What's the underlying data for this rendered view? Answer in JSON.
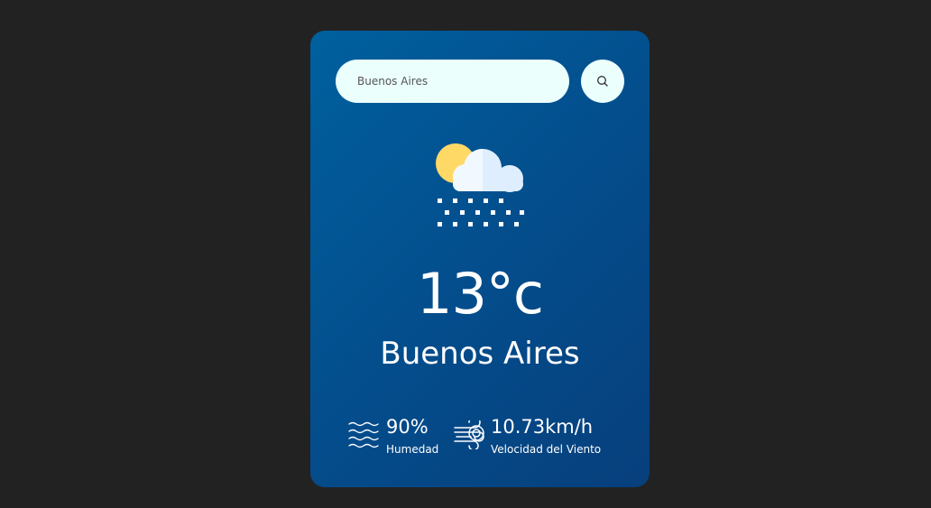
{
  "search": {
    "value": "Buenos Aires",
    "button_icon": "search-icon"
  },
  "weather": {
    "icon": "sun-cloud-snow-icon",
    "temperature": "13°c",
    "city": "Buenos Aires"
  },
  "details": {
    "humidity": {
      "icon": "waves-icon",
      "value": "90%",
      "label": "Humedad"
    },
    "wind": {
      "icon": "wind-icon",
      "value": "10.73km/h",
      "label": "Velocidad del Viento"
    }
  },
  "colors": {
    "background": "#222222",
    "card_top": "#00609e",
    "card_bottom": "#073f7c",
    "input_bg": "#ebfffd",
    "sun": "#ffd966",
    "cloud": "#dfeeff"
  }
}
